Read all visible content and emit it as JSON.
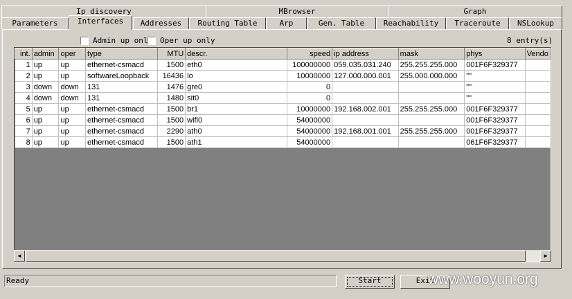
{
  "tabs_row1": [
    "Ip discovery",
    "MBrowser",
    "Graph"
  ],
  "tabs_row2": [
    "Parameters",
    "Interfaces",
    "Addresses",
    "Routing Table",
    "Arp",
    "Gen. Table",
    "Reachability",
    "Traceroute",
    "NSLookup"
  ],
  "active_tab": "Interfaces",
  "filters": {
    "admin_up_only": "Admin up onl",
    "oper_up_only": "Oper up only"
  },
  "entry_count": "8 entry(s)",
  "table": {
    "columns": [
      "int.",
      "admin",
      "oper",
      "type",
      "MTU",
      "descr.",
      "speed",
      "ip address",
      "mask",
      "phys",
      "Vendo"
    ],
    "rows": [
      [
        "1",
        "up",
        "up",
        "ethernet-csmacd",
        "1500",
        "eth0",
        "100000000",
        "059.035.031.240",
        "255.255.255.000",
        "001F6F329377",
        ""
      ],
      [
        "2",
        "up",
        "up",
        "softwareLoopback",
        "16436",
        "lo",
        "10000000",
        "127.000.000.001",
        "255.000.000.000",
        "\"\"",
        ""
      ],
      [
        "3",
        "down",
        "down",
        "131",
        "1476",
        "gre0",
        "0",
        "",
        "",
        "\"\"",
        ""
      ],
      [
        "4",
        "down",
        "down",
        "131",
        "1480",
        "sit0",
        "0",
        "",
        "",
        "\"\"",
        ""
      ],
      [
        "5",
        "up",
        "up",
        "ethernet-csmacd",
        "1500",
        "br1",
        "10000000",
        "192.168.002.001",
        "255.255.255.000",
        "001F6F329377",
        ""
      ],
      [
        "6",
        "up",
        "up",
        "ethernet-csmacd",
        "1500",
        "wifi0",
        "54000000",
        "",
        "",
        "001F6F329377",
        ""
      ],
      [
        "7",
        "up",
        "up",
        "ethernet-csmacd",
        "2290",
        "ath0",
        "54000000",
        "192.168.001.001",
        "255.255.255.000",
        "001F6F329377",
        ""
      ],
      [
        "8",
        "up",
        "up",
        "ethernet-csmacd",
        "1500",
        "ath1",
        "54000000",
        "",
        "",
        "061F6F329377",
        ""
      ]
    ]
  },
  "status_text": "Ready",
  "start_label": "Start",
  "exit_label": "Exit",
  "watermark": "www.wooyun.org"
}
